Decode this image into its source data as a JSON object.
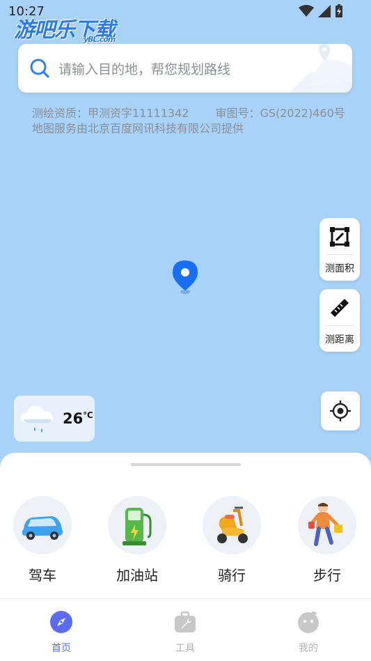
{
  "status_bar": {
    "time": "10:27"
  },
  "watermark": {
    "text": "游吧乐下载",
    "sub": "yBL.com"
  },
  "search": {
    "placeholder": "请输入目的地，帮您规划路线"
  },
  "license": {
    "survey": "测绘资质：甲测资字11111342",
    "approval": "审图号：GS(2022)460号",
    "provider": "地图服务由北京百度网讯科技有限公司提供"
  },
  "tools": [
    {
      "label": "测面积",
      "icon": "area-measure-icon"
    },
    {
      "label": "测距离",
      "icon": "ruler-icon"
    }
  ],
  "weather": {
    "temp": "26",
    "unit": "℃",
    "icon": "rain-cloud-icon"
  },
  "modes": [
    {
      "label": "驾车",
      "icon": "car-icon"
    },
    {
      "label": "加油站",
      "icon": "gas-pump-icon"
    },
    {
      "label": "骑行",
      "icon": "scooter-icon"
    },
    {
      "label": "步行",
      "icon": "walker-icon"
    }
  ],
  "tabs": [
    {
      "label": "首页",
      "icon": "compass-icon",
      "active": true
    },
    {
      "label": "工具",
      "icon": "toolbox-icon",
      "active": false
    },
    {
      "label": "我的",
      "icon": "profile-icon",
      "active": false
    }
  ],
  "colors": {
    "map_bg": "#a8d2f8",
    "accent": "#5b6cf2",
    "pin": "#1a6ef5"
  }
}
